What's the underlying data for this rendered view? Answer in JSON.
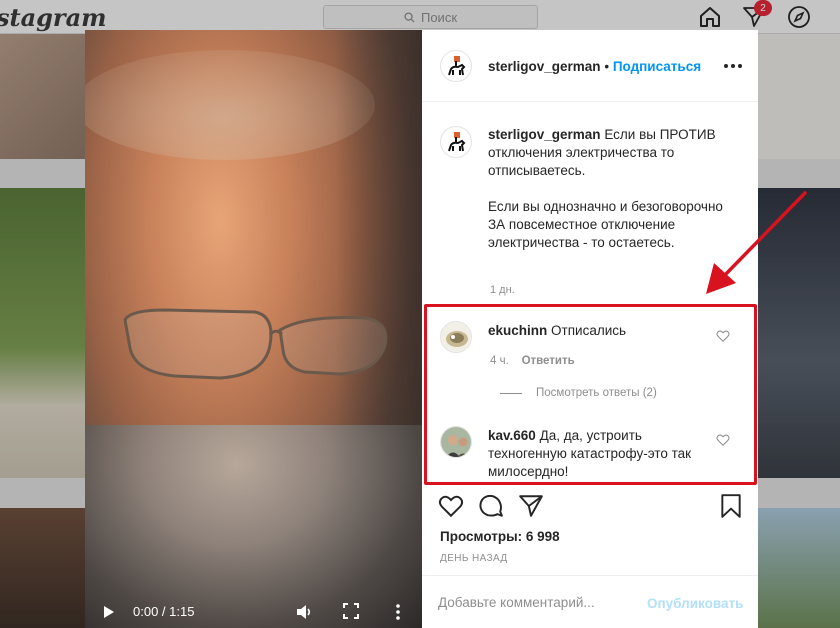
{
  "top_bar": {
    "logo_text": "stagram",
    "search_placeholder": "Поиск",
    "notification_count": "2"
  },
  "post": {
    "author": "sterligov_german",
    "separator": "•",
    "follow_label": "Подписаться",
    "caption_paragraphs": [
      "Если вы ПРОТИВ отключения электричества то отписываетесь.",
      "Если вы однозначно и безоговорочно ЗА повсеместное отключение электричества - то остаетесь."
    ],
    "caption_time": "1 дн.",
    "comments": [
      {
        "user": "ekuchinn",
        "text": "Отписались",
        "time": "4 ч.",
        "reply_label": "Ответить",
        "view_replies_label": "Посмотреть ответы (2)"
      },
      {
        "user": "kav.660",
        "text": "Да, да, устроить техногенную катастрофу-это так милосердно!"
      }
    ],
    "views_label": "Просмотры:",
    "views_count": "6 998",
    "posted_when": "ДЕНЬ НАЗАД",
    "comment_placeholder": "Добавьте комментарий...",
    "publish_label": "Опубликовать"
  },
  "video": {
    "time_display": "0:00 / 1:15",
    "progress": 0.0
  },
  "colors": {
    "accent": "#0095f6",
    "highlight": "#d8121f",
    "badge": "#e0293a"
  },
  "icons": [
    "home-icon",
    "direct-icon",
    "explore-icon",
    "more-icon",
    "heart-icon",
    "comment-icon",
    "share-icon",
    "bookmark-icon",
    "play-icon",
    "volume-icon",
    "fullscreen-icon"
  ]
}
